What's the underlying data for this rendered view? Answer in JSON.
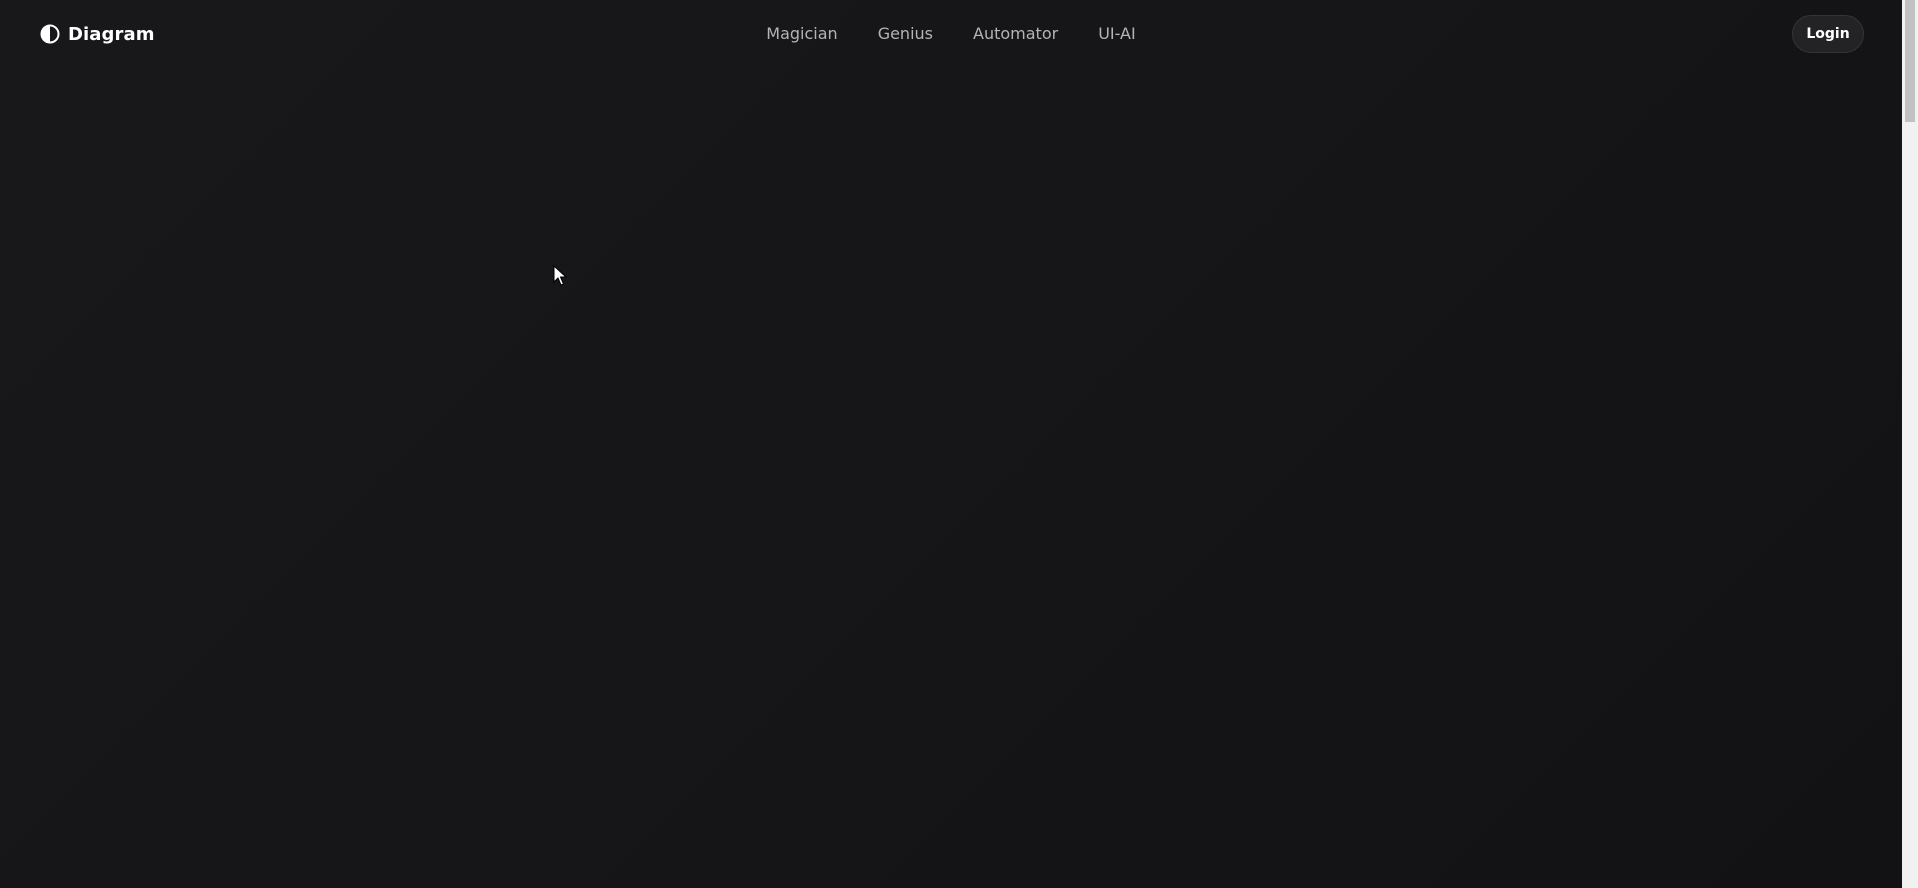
{
  "brand": {
    "name": "Diagram",
    "icon": "half-circle-logo-icon"
  },
  "nav": {
    "links": [
      {
        "label": "Magician"
      },
      {
        "label": "Genius"
      },
      {
        "label": "Automator"
      },
      {
        "label": "UI-AI"
      }
    ]
  },
  "header": {
    "login_label": "Login"
  },
  "colors": {
    "background": "#161618",
    "nav_text": "#b4b4b7",
    "brand_text": "#ffffff",
    "button_bg": "#232325"
  }
}
